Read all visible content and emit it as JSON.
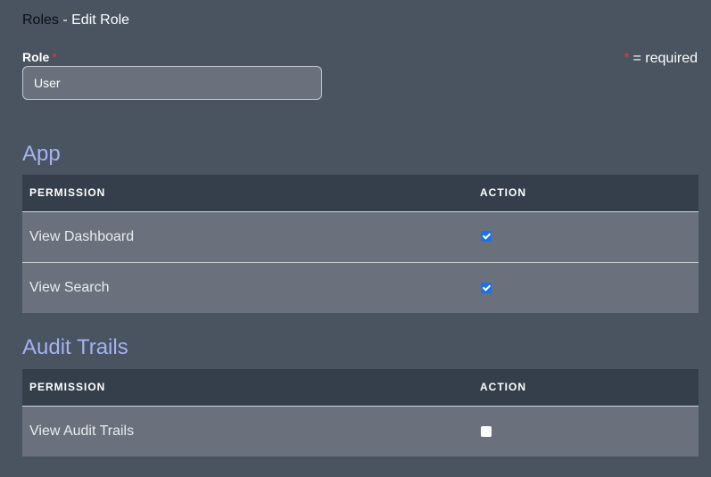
{
  "breadcrumb": {
    "parent": "Roles",
    "separator": " - ",
    "current": "Edit Role"
  },
  "form": {
    "role_label": "Role",
    "required_star": "*",
    "role_value": "User",
    "required_note": "= required"
  },
  "sections": [
    {
      "title": "App",
      "headers": {
        "permission": "PERMISSION",
        "action": "ACTION"
      },
      "rows": [
        {
          "permission": "View Dashboard",
          "checked": true
        },
        {
          "permission": "View Search",
          "checked": true
        }
      ]
    },
    {
      "title": "Audit Trails",
      "headers": {
        "permission": "PERMISSION",
        "action": "ACTION"
      },
      "rows": [
        {
          "permission": "View Audit Trails",
          "checked": false
        }
      ]
    }
  ],
  "colors": {
    "background": "#4a5360",
    "section_title": "#a4b2f3",
    "table_header": "#353e4b",
    "table_row": "#6b717c",
    "checkbox_checked": "#1a73e8",
    "required_star": "#e03a3a"
  }
}
